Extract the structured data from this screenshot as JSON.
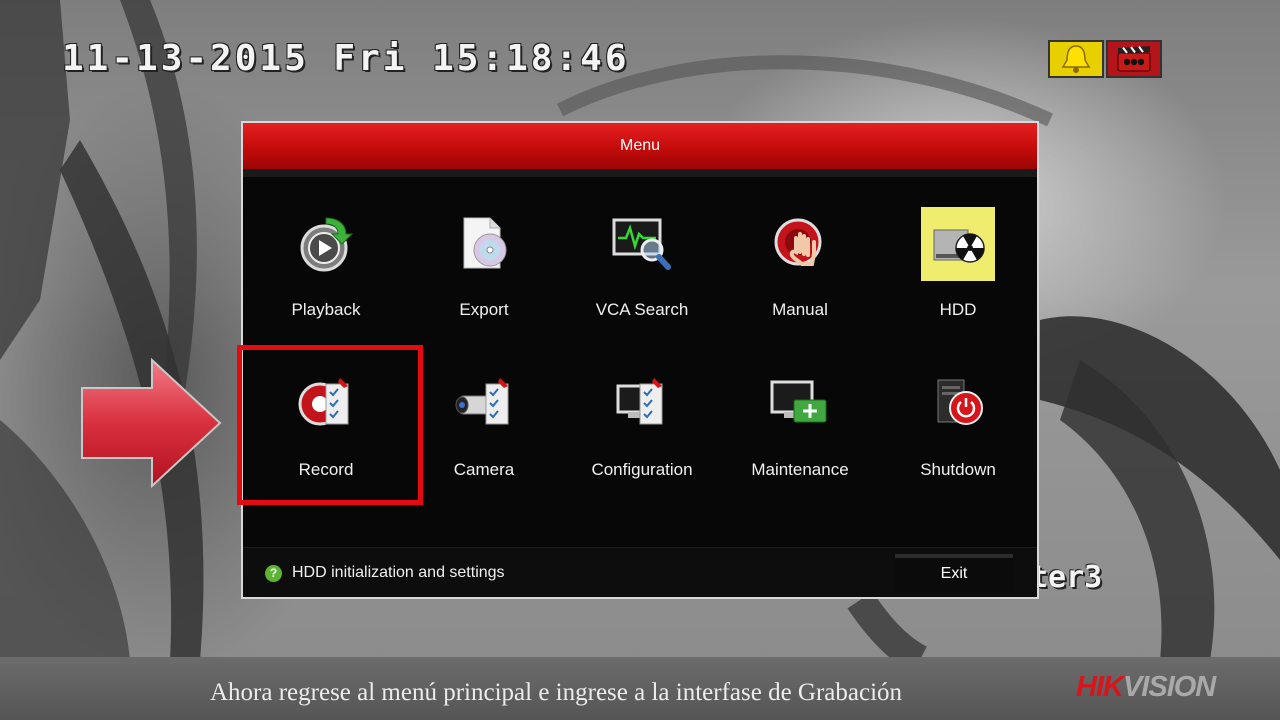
{
  "osd": {
    "datetime": "11-13-2015 Fri 15:18:46",
    "channel_label": "ter3"
  },
  "status_icons": [
    "bell-alarm-icon",
    "record-status-icon"
  ],
  "menu": {
    "title": "Menu",
    "items": [
      {
        "label": "Playback",
        "icon": "playback-icon"
      },
      {
        "label": "Export",
        "icon": "export-icon"
      },
      {
        "label": "VCA Search",
        "icon": "vca-search-icon"
      },
      {
        "label": "Manual",
        "icon": "manual-icon"
      },
      {
        "label": "HDD",
        "icon": "hdd-icon"
      },
      {
        "label": "Record",
        "icon": "record-icon"
      },
      {
        "label": "Camera",
        "icon": "camera-icon"
      },
      {
        "label": "Configuration",
        "icon": "configuration-icon"
      },
      {
        "label": "Maintenance",
        "icon": "maintenance-icon"
      },
      {
        "label": "Shutdown",
        "icon": "shutdown-icon"
      }
    ],
    "selected": "Record",
    "hint": "HDD initialization and settings",
    "exit_label": "Exit"
  },
  "caption": {
    "text": "Ahora regrese al menú principal e ingrese a la interfase de Grabación",
    "brand_part1": "HIK",
    "brand_part2": "VISION"
  },
  "colors": {
    "accent_red": "#e30a10",
    "title_bar_red": "#d21010",
    "hint_green": "#5bb531"
  }
}
